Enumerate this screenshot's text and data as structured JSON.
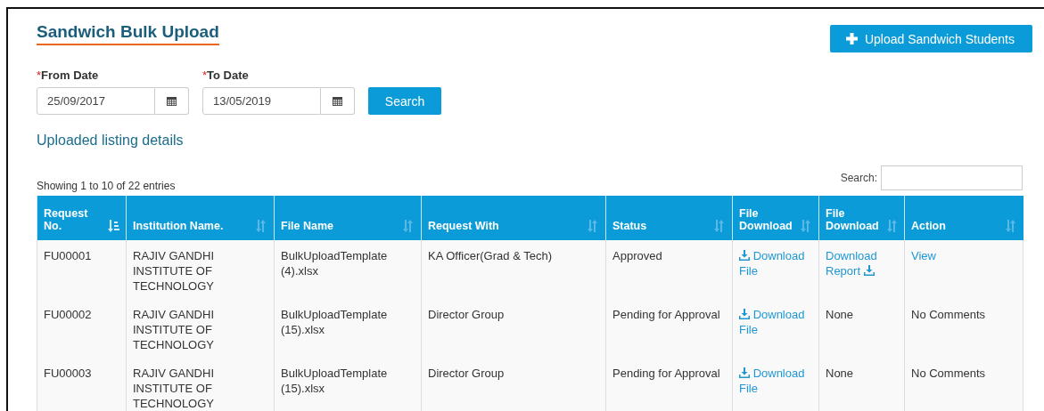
{
  "title": "Sandwich Bulk Upload",
  "upload_button": {
    "label": "Upload Sandwich Students"
  },
  "filters": [
    {
      "label": "From Date",
      "required_mark": "*",
      "value": "25/09/2017"
    },
    {
      "label": "To Date",
      "required_mark": "*",
      "value": "13/05/2019"
    }
  ],
  "search_button": {
    "label": "Search"
  },
  "section_title": "Uploaded listing details",
  "entries_info": "Showing 1 to 10 of 22 entries",
  "table_search": {
    "label": "Search:"
  },
  "table": {
    "columns": [
      {
        "label": "Request No.",
        "sorted": true
      },
      {
        "label": "Institution Name.",
        "sorted": false
      },
      {
        "label": "File Name",
        "sorted": false
      },
      {
        "label": "Request With",
        "sorted": false
      },
      {
        "label": "Status",
        "sorted": false
      },
      {
        "label": "File Download",
        "sorted": false
      },
      {
        "label": "File Download",
        "sorted": false
      },
      {
        "label": "Action",
        "sorted": false
      }
    ],
    "rows": [
      [
        {
          "kind": "text",
          "text": "FU00001"
        },
        {
          "kind": "text",
          "text": "RAJIV GANDHI INSTITUTE OF TECHNOLOGY"
        },
        {
          "kind": "text",
          "text": "BulkUploadTemplate (4).xlsx"
        },
        {
          "kind": "text",
          "text": "KA Officer(Grad & Tech)"
        },
        {
          "kind": "text",
          "text": "Approved"
        },
        {
          "kind": "download_link",
          "text": "Download File"
        },
        {
          "kind": "report_link",
          "text": "Download Report"
        },
        {
          "kind": "link",
          "text": "View"
        }
      ],
      [
        {
          "kind": "text",
          "text": "FU00002"
        },
        {
          "kind": "text",
          "text": "RAJIV GANDHI INSTITUTE OF TECHNOLOGY"
        },
        {
          "kind": "text",
          "text": "BulkUploadTemplate (15).xlsx"
        },
        {
          "kind": "text",
          "text": "Director Group"
        },
        {
          "kind": "text",
          "text": "Pending for Approval"
        },
        {
          "kind": "download_link",
          "text": "Download File"
        },
        {
          "kind": "text",
          "text": "None"
        },
        {
          "kind": "text",
          "text": "No Comments"
        }
      ],
      [
        {
          "kind": "text",
          "text": "FU00003"
        },
        {
          "kind": "text",
          "text": "RAJIV GANDHI INSTITUTE OF TECHNOLOGY"
        },
        {
          "kind": "text",
          "text": "BulkUploadTemplate (15).xlsx"
        },
        {
          "kind": "text",
          "text": "Director Group"
        },
        {
          "kind": "text",
          "text": "Pending for Approval"
        },
        {
          "kind": "download_link",
          "text": "Download File"
        },
        {
          "kind": "text",
          "text": "None"
        },
        {
          "kind": "text",
          "text": "No Comments"
        }
      ]
    ]
  }
}
